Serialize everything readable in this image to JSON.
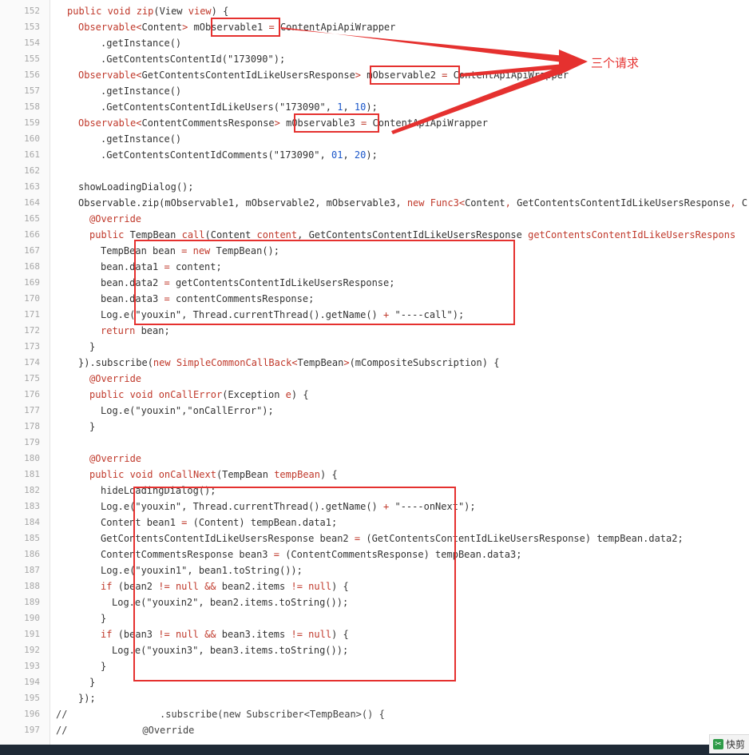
{
  "callout_text": "三个请求",
  "watermark_label": "快剪",
  "lines": [
    {
      "n": "152",
      "indent": 2,
      "t": [
        [
          "kw",
          "public "
        ],
        [
          "kw",
          "void "
        ],
        [
          "fn",
          "zip"
        ],
        [
          "p",
          "(View "
        ],
        [
          "kw",
          "view"
        ],
        [
          "p",
          ") {"
        ]
      ]
    },
    {
      "n": "153",
      "indent": 4,
      "t": [
        [
          "cl",
          "Observable<"
        ],
        [
          "p",
          "Content"
        ],
        [
          "cl",
          "> "
        ],
        [
          "p",
          "mObservable1 "
        ],
        [
          "cl",
          "= "
        ],
        [
          "p",
          "ContentApiApiWrapper"
        ]
      ]
    },
    {
      "n": "154",
      "indent": 8,
      "t": [
        [
          "p",
          ".getInstance()"
        ]
      ]
    },
    {
      "n": "155",
      "indent": 8,
      "t": [
        [
          "p",
          ".GetContentsContentId(\"173090\");"
        ]
      ]
    },
    {
      "n": "156",
      "indent": 4,
      "t": [
        [
          "cl",
          "Observable<"
        ],
        [
          "p",
          "GetContentsContentIdLikeUsersResponse"
        ],
        [
          "cl",
          "> "
        ],
        [
          "p",
          "mObservable2 "
        ],
        [
          "cl",
          "= "
        ],
        [
          "p",
          "ContentApiApiWrapper"
        ]
      ]
    },
    {
      "n": "157",
      "indent": 8,
      "t": [
        [
          "p",
          ".getInstance()"
        ]
      ]
    },
    {
      "n": "158",
      "indent": 8,
      "t": [
        [
          "p",
          ".GetContentsContentIdLikeUsers(\"173090\", "
        ],
        [
          "num",
          "1"
        ],
        [
          "p",
          ", "
        ],
        [
          "num",
          "10"
        ],
        [
          "p",
          ");"
        ]
      ]
    },
    {
      "n": "159",
      "indent": 4,
      "t": [
        [
          "cl",
          "Observable<"
        ],
        [
          "p",
          "ContentCommentsResponse"
        ],
        [
          "cl",
          "> "
        ],
        [
          "p",
          "mObservable3 "
        ],
        [
          "cl",
          "= "
        ],
        [
          "p",
          "ContentApiApiWrapper"
        ]
      ]
    },
    {
      "n": "160",
      "indent": 8,
      "t": [
        [
          "p",
          ".getInstance()"
        ]
      ]
    },
    {
      "n": "161",
      "indent": 8,
      "t": [
        [
          "p",
          ".GetContentsContentIdComments(\"173090\", "
        ],
        [
          "num",
          "01"
        ],
        [
          "p",
          ", "
        ],
        [
          "num",
          "20"
        ],
        [
          "p",
          ");"
        ]
      ]
    },
    {
      "n": "162",
      "indent": 0,
      "t": []
    },
    {
      "n": "163",
      "indent": 4,
      "t": [
        [
          "p",
          "showLoadingDialog();"
        ]
      ]
    },
    {
      "n": "164",
      "indent": 4,
      "t": [
        [
          "p",
          "Observable.zip(mObservable1, mObservable2, mObservable3, "
        ],
        [
          "kw",
          "new "
        ],
        [
          "cl",
          "Func3<"
        ],
        [
          "p",
          "Content"
        ],
        [
          "cl",
          ", "
        ],
        [
          "p",
          "GetContentsContentIdLikeUsersResponse"
        ],
        [
          "cl",
          ", "
        ],
        [
          "p",
          "C"
        ]
      ]
    },
    {
      "n": "165",
      "indent": 6,
      "t": [
        [
          "ann",
          "@Override"
        ]
      ]
    },
    {
      "n": "166",
      "indent": 6,
      "t": [
        [
          "kw",
          "public "
        ],
        [
          "p",
          "TempBean "
        ],
        [
          "fn",
          "call"
        ],
        [
          "p",
          "(Content "
        ],
        [
          "kw",
          "content"
        ],
        [
          "p",
          ", GetContentsContentIdLikeUsersResponse "
        ],
        [
          "kw",
          "getContentsContentIdLikeUsersRespons"
        ]
      ]
    },
    {
      "n": "167",
      "indent": 8,
      "t": [
        [
          "p",
          "TempBean bean "
        ],
        [
          "cl",
          "= "
        ],
        [
          "kw",
          "new "
        ],
        [
          "p",
          "TempBean();"
        ]
      ]
    },
    {
      "n": "168",
      "indent": 8,
      "t": [
        [
          "p",
          "bean.data1 "
        ],
        [
          "cl",
          "= "
        ],
        [
          "p",
          "content;"
        ]
      ]
    },
    {
      "n": "169",
      "indent": 8,
      "t": [
        [
          "p",
          "bean.data2 "
        ],
        [
          "cl",
          "= "
        ],
        [
          "p",
          "getContentsContentIdLikeUsersResponse;"
        ]
      ]
    },
    {
      "n": "170",
      "indent": 8,
      "t": [
        [
          "p",
          "bean.data3 "
        ],
        [
          "cl",
          "= "
        ],
        [
          "p",
          "contentCommentsResponse;"
        ]
      ]
    },
    {
      "n": "171",
      "indent": 8,
      "t": [
        [
          "p",
          "Log.e(\"youxin\", Thread.currentThread().getName() "
        ],
        [
          "cl",
          "+ "
        ],
        [
          "p",
          "\"----call\");"
        ]
      ]
    },
    {
      "n": "172",
      "indent": 8,
      "t": [
        [
          "kw",
          "return "
        ],
        [
          "p",
          "bean;"
        ]
      ]
    },
    {
      "n": "173",
      "indent": 6,
      "t": [
        [
          "p",
          "}"
        ]
      ]
    },
    {
      "n": "174",
      "indent": 4,
      "t": [
        [
          "p",
          "}).subscribe("
        ],
        [
          "kw",
          "new "
        ],
        [
          "cl",
          "SimpleCommonCallBack<"
        ],
        [
          "p",
          "TempBean"
        ],
        [
          "cl",
          ">"
        ],
        [
          "p",
          "(mCompositeSubscription) {"
        ]
      ]
    },
    {
      "n": "175",
      "indent": 6,
      "t": [
        [
          "ann",
          "@Override"
        ]
      ]
    },
    {
      "n": "176",
      "indent": 6,
      "t": [
        [
          "kw",
          "public "
        ],
        [
          "kw",
          "void "
        ],
        [
          "fn",
          "onCallError"
        ],
        [
          "p",
          "(Exception "
        ],
        [
          "kw",
          "e"
        ],
        [
          "p",
          ") {"
        ]
      ]
    },
    {
      "n": "177",
      "indent": 8,
      "t": [
        [
          "p",
          "Log.e(\"youxin\",\"onCallError\");"
        ]
      ]
    },
    {
      "n": "178",
      "indent": 6,
      "t": [
        [
          "p",
          "}"
        ]
      ]
    },
    {
      "n": "179",
      "indent": 0,
      "t": []
    },
    {
      "n": "180",
      "indent": 6,
      "t": [
        [
          "ann",
          "@Override"
        ]
      ]
    },
    {
      "n": "181",
      "indent": 6,
      "t": [
        [
          "kw",
          "public "
        ],
        [
          "kw",
          "void "
        ],
        [
          "fn",
          "onCallNext"
        ],
        [
          "p",
          "(TempBean "
        ],
        [
          "kw",
          "tempBean"
        ],
        [
          "p",
          ") {"
        ]
      ]
    },
    {
      "n": "182",
      "indent": 8,
      "t": [
        [
          "p",
          "hideLoadingDialog();"
        ]
      ]
    },
    {
      "n": "183",
      "indent": 8,
      "t": [
        [
          "p",
          "Log.e(\"youxin\", Thread.currentThread().getName() "
        ],
        [
          "cl",
          "+ "
        ],
        [
          "p",
          "\"----onNext\");"
        ]
      ]
    },
    {
      "n": "184",
      "indent": 8,
      "t": [
        [
          "p",
          "Content bean1 "
        ],
        [
          "cl",
          "= "
        ],
        [
          "p",
          "(Content) tempBean.data1;"
        ]
      ]
    },
    {
      "n": "185",
      "indent": 8,
      "t": [
        [
          "p",
          "GetContentsContentIdLikeUsersResponse bean2 "
        ],
        [
          "cl",
          "= "
        ],
        [
          "p",
          "(GetContentsContentIdLikeUsersResponse) tempBean.data2;"
        ]
      ]
    },
    {
      "n": "186",
      "indent": 8,
      "t": [
        [
          "p",
          "ContentCommentsResponse bean3 "
        ],
        [
          "cl",
          "= "
        ],
        [
          "p",
          "(ContentCommentsResponse) tempBean.data3;"
        ]
      ]
    },
    {
      "n": "187",
      "indent": 8,
      "t": [
        [
          "p",
          "Log.e(\"youxin1\", bean1.toString());"
        ]
      ]
    },
    {
      "n": "188",
      "indent": 8,
      "t": [
        [
          "kw",
          "if "
        ],
        [
          "p",
          "(bean2 "
        ],
        [
          "cl",
          "!= "
        ],
        [
          "kw",
          "null "
        ],
        [
          "cl",
          "&& "
        ],
        [
          "p",
          "bean2.items "
        ],
        [
          "cl",
          "!= "
        ],
        [
          "kw",
          "null"
        ],
        [
          "p",
          ") {"
        ]
      ]
    },
    {
      "n": "189",
      "indent": 10,
      "t": [
        [
          "p",
          "Log.e(\"youxin2\", bean2.items.toString());"
        ]
      ]
    },
    {
      "n": "190",
      "indent": 8,
      "t": [
        [
          "p",
          "}"
        ]
      ]
    },
    {
      "n": "191",
      "indent": 8,
      "t": [
        [
          "kw",
          "if "
        ],
        [
          "p",
          "(bean3 "
        ],
        [
          "cl",
          "!= "
        ],
        [
          "kw",
          "null "
        ],
        [
          "cl",
          "&& "
        ],
        [
          "p",
          "bean3.items "
        ],
        [
          "cl",
          "!= "
        ],
        [
          "kw",
          "null"
        ],
        [
          "p",
          ") {"
        ]
      ]
    },
    {
      "n": "192",
      "indent": 10,
      "t": [
        [
          "p",
          "Log.e(\"youxin3\", bean3.items.toString());"
        ]
      ]
    },
    {
      "n": "193",
      "indent": 8,
      "t": [
        [
          "p",
          "}"
        ]
      ]
    },
    {
      "n": "194",
      "indent": 6,
      "t": [
        [
          "p",
          "}"
        ]
      ]
    },
    {
      "n": "195",
      "indent": 4,
      "t": [
        [
          "p",
          "});"
        ]
      ]
    },
    {
      "n": "196",
      "indent": 0,
      "t": [
        [
          "cm",
          "//                .subscribe(new Subscriber<TempBean>() {"
        ]
      ]
    },
    {
      "n": "197",
      "indent": 0,
      "t": [
        [
          "cm",
          "//             @Override"
        ]
      ]
    }
  ]
}
